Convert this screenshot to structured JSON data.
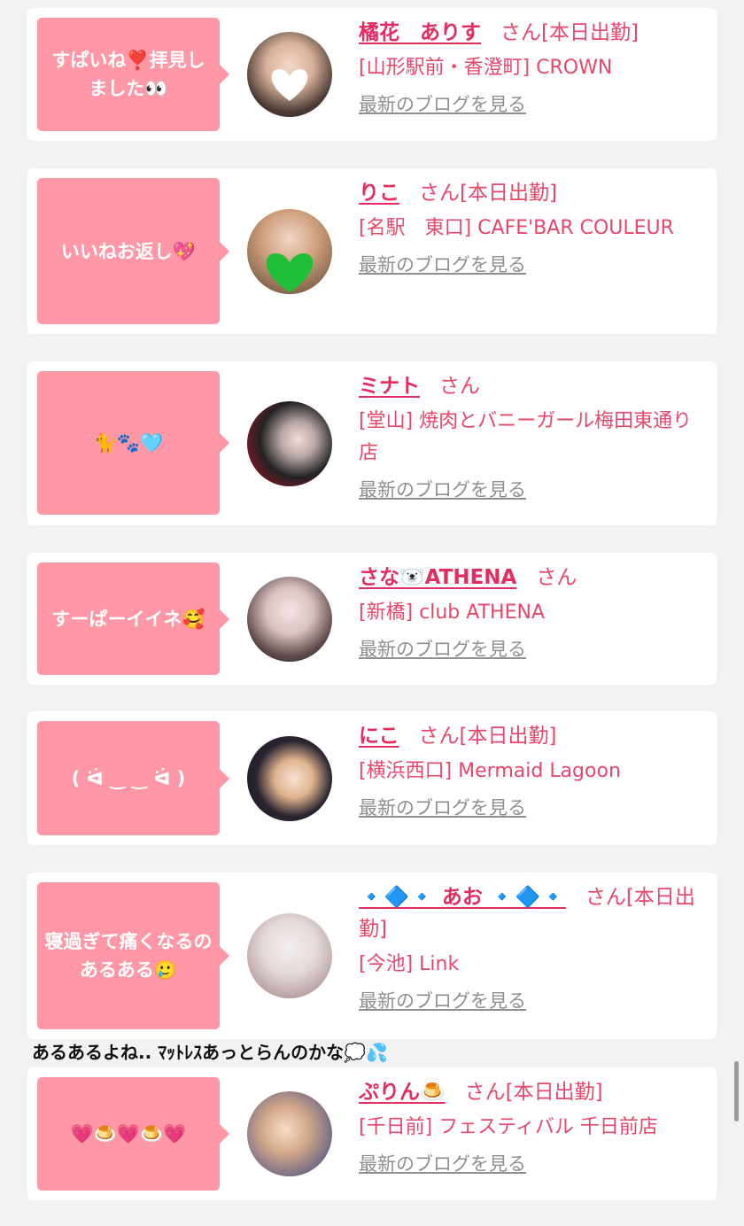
{
  "items": [
    {
      "message": "すぱいね❣️拝見しました👀",
      "name": "橘花　ありす",
      "suffix": "さん[本日出勤]",
      "shop": "[山形駅前・香澄町] CROWN",
      "blog_link": "最新のブログを見る"
    },
    {
      "message": "いいねお返し💖",
      "name": "りこ",
      "suffix": "さん[本日出勤]",
      "shop": "[名駅　東口] CAFE'BAR COULEUR",
      "blog_link": "最新のブログを見る"
    },
    {
      "message": "🐈🐾🩵",
      "name": "ミナト",
      "suffix": "さん",
      "shop": "[堂山] 焼肉とバニーガール梅田東通り店",
      "blog_link": "最新のブログを見る"
    },
    {
      "message": "すーぱーイイネ🥰",
      "name": "さな🐻‍❄️ATHENA",
      "suffix": "さん",
      "shop": "[新橋] club ATHENA",
      "blog_link": "最新のブログを見る"
    },
    {
      "message": "( ᐛ ‿ ‿ ᐛ )",
      "name": "にこ",
      "suffix": "さん[本日出勤]",
      "shop": "[横浜西口] Mermaid Lagoon",
      "blog_link": "最新のブログを見る"
    },
    {
      "message": "寝過ぎて痛くなるのあるある🥲",
      "name": "🔹🔷🔹 あお 🔹🔷🔹",
      "suffix": "さん[本日出勤]",
      "shop": "[今池] Link",
      "blog_link": "最新のブログを見る"
    },
    {
      "message": "💗🍮💗🍮💗",
      "name": "ぷりん🍮",
      "suffix": "さん[本日出勤]",
      "shop": "[千日前] フェスティバル 千日前店",
      "blog_link": "最新のブログを見る"
    }
  ],
  "owner_comment": "あるあるよね.. ﾏｯﾄﾚｽあっとらんのかな💭💦",
  "colors": {
    "accent_pink": "#ff97a6",
    "name_red": "#e32d5e",
    "background": "#f2f2f2"
  }
}
